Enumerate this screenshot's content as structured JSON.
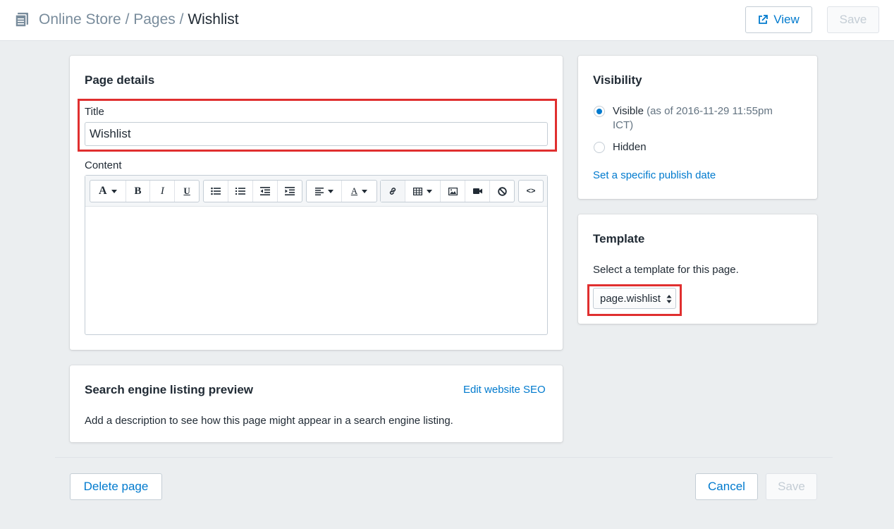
{
  "header": {
    "breadcrumb": {
      "part1": "Online Store",
      "sep1": " / ",
      "part2": "Pages",
      "sep2": " / ",
      "current": "Wishlist"
    },
    "view_label": "View",
    "save_label": "Save"
  },
  "page_details": {
    "heading": "Page details",
    "title_label": "Title",
    "title_value": "Wishlist",
    "content_label": "Content",
    "toolbar_icons": [
      "font-icon",
      "bold-icon",
      "italic-icon",
      "underline-icon",
      "bullet-list-icon",
      "numbered-list-icon",
      "outdent-icon",
      "indent-icon",
      "align-icon",
      "text-color-icon",
      "link-icon",
      "table-icon",
      "image-icon",
      "video-icon",
      "clear-format-icon",
      "code-icon"
    ],
    "toolbar_glyphs": {
      "font": "A",
      "bold": "B",
      "italic": "I",
      "underline": "U",
      "text_color": "A",
      "code": "<>"
    }
  },
  "seo": {
    "heading": "Search engine listing preview",
    "edit_link": "Edit website SEO",
    "description": "Add a description to see how this page might appear in a search engine listing."
  },
  "visibility": {
    "heading": "Visibility",
    "visible_label": "Visible",
    "visible_note_line1": "(as of 2016-11-29 11:55pm",
    "visible_note_line2": "ICT)",
    "hidden_label": "Hidden",
    "publish_link": "Set a specific publish date",
    "selected": "Visible"
  },
  "template": {
    "heading": "Template",
    "description": "Select a template for this page.",
    "selected": "page.wishlist"
  },
  "footer": {
    "delete_label": "Delete page",
    "cancel_label": "Cancel",
    "save_label": "Save"
  },
  "colors": {
    "accent": "#007ace",
    "highlight": "#e02f2f",
    "background": "#ebeef0"
  }
}
